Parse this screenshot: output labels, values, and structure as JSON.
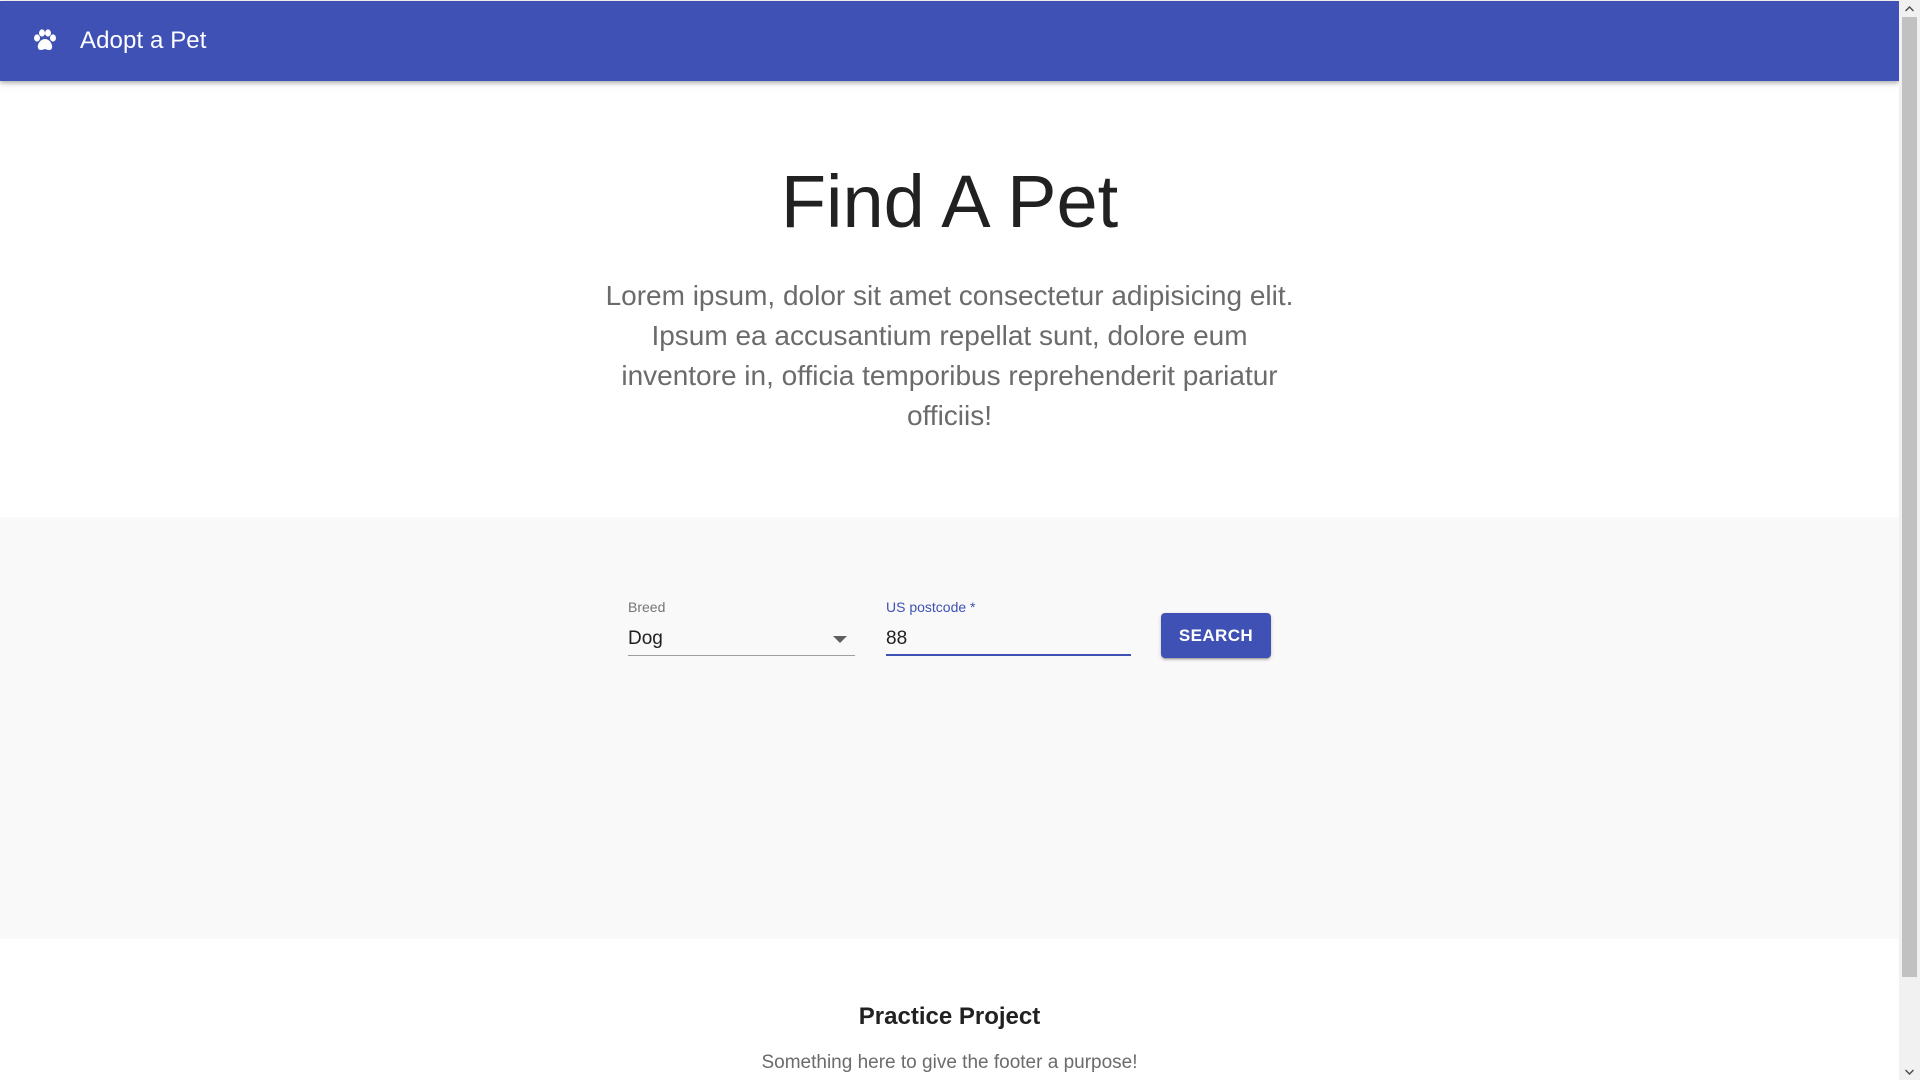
{
  "appbar": {
    "icon": "paw-icon",
    "title": "Adopt a Pet",
    "color": "#3f51b5"
  },
  "hero": {
    "title": "Find A Pet",
    "description": "Lorem ipsum, dolor sit amet consectetur adipisicing elit. Ipsum ea accusantium repellat sunt, dolore eum inventore in, officia temporibus reprehenderit pariatur officiis!"
  },
  "search": {
    "breed": {
      "label": "Breed",
      "value": "Dog"
    },
    "postcode": {
      "label": "US postcode *",
      "value": "88"
    },
    "button_label": "SEARCH"
  },
  "footer": {
    "title": "Practice Project",
    "subtitle": "Something here to give the footer a purpose!"
  }
}
